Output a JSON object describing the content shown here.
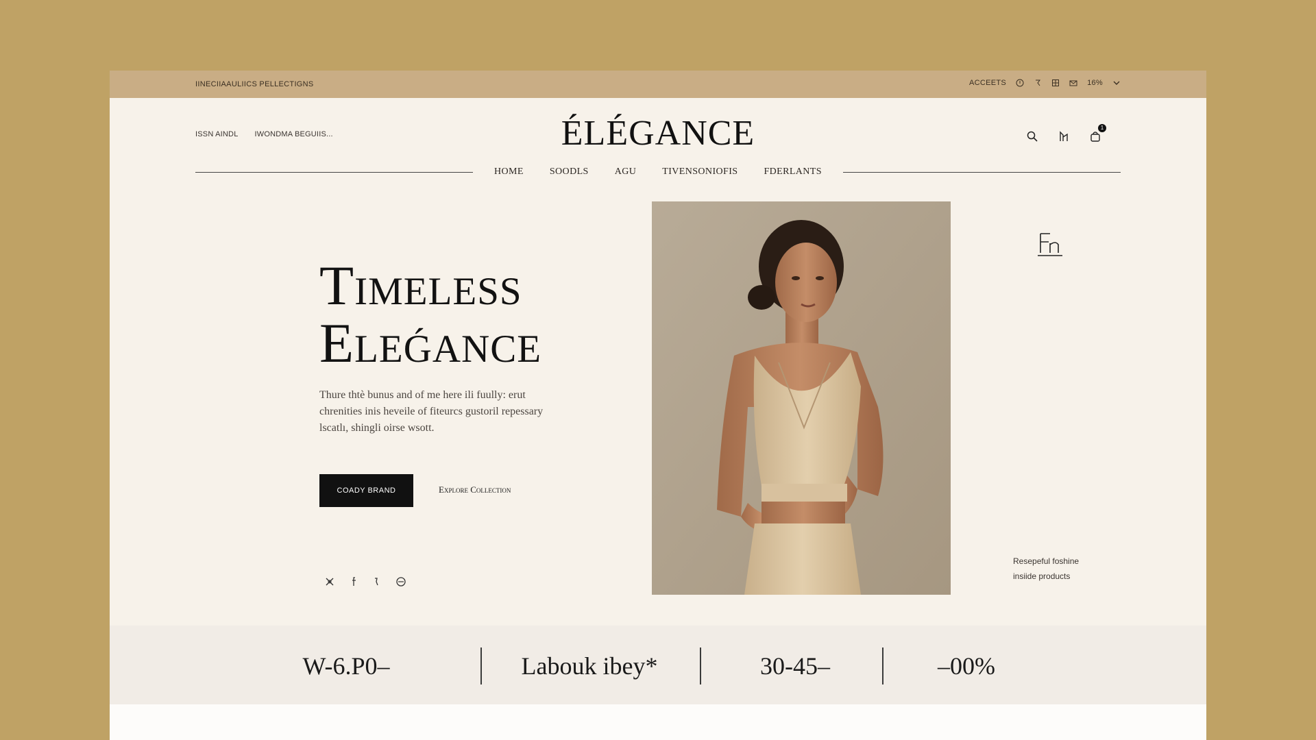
{
  "colors": {
    "background": "#bfa265",
    "topbar": "#c9ad85",
    "page": "#f7f2ea",
    "primary_button": "#111111",
    "stats_band": "#f1ece6"
  },
  "topbar": {
    "left_text": "IINECIIAAULIICS PELLECTIGNS",
    "right_items": [
      "ACCEETS",
      "16%"
    ],
    "icons": [
      "info-icon",
      "flag-icon",
      "grid-icon",
      "mail-icon",
      "chevron-down-icon"
    ]
  },
  "header": {
    "links": [
      "ISSN AINDL",
      "IWONDMA BEGUIIS..."
    ],
    "logo": "ÉLÉGANCE",
    "icons": [
      "search-icon",
      "wishlist-icon",
      "cart-icon"
    ],
    "cart_count": "1"
  },
  "nav": {
    "items": [
      "HOME",
      "SOODLS",
      "AGU",
      "TIVENSONIOFIS",
      "FDERLANTS"
    ]
  },
  "hero": {
    "title_line1": "Timeless",
    "title_line2": "Eleǵance",
    "description": "Thure thtè bunus and of me here ili fuully: erut chrenities inis heveile of fiteurcs gustoril repessary lscatlı, shingli oirse wsott.",
    "primary_button": "COADY BRAND",
    "secondary_button": "Explore Collection",
    "social_icons": [
      "pinterest-icon",
      "facebook-icon",
      "twitter-icon",
      "instagram-icon"
    ]
  },
  "aside": {
    "mark": "Fn",
    "note_line1": "Resepeful foshine",
    "note_line2": "insiide products"
  },
  "stats": [
    "W-6.P0–",
    "Labouk ibey*",
    "30-45–",
    "–00%"
  ]
}
